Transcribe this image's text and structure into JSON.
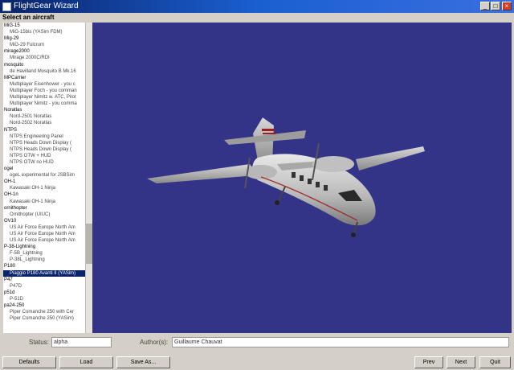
{
  "window": {
    "title": "FlightGear Wizard",
    "minimize": "_",
    "maximize": "□",
    "close": "×"
  },
  "heading": "Select an aircraft",
  "aircraft_list": [
    {
      "label": "MiG-15",
      "kind": "parent"
    },
    {
      "label": "MiG-15bis (YASim FDM)",
      "kind": "child"
    },
    {
      "label": "Mig-29",
      "kind": "parent"
    },
    {
      "label": "MiG-29 Fulcrum",
      "kind": "child"
    },
    {
      "label": "mirage2000",
      "kind": "parent"
    },
    {
      "label": "Mirage 2000C/RDI",
      "kind": "child"
    },
    {
      "label": "mosquito",
      "kind": "parent"
    },
    {
      "label": "de Havilland Mosquito B Mk.16",
      "kind": "child"
    },
    {
      "label": "MPCarrier",
      "kind": "parent"
    },
    {
      "label": "Multiplayer Eisenhower - you c",
      "kind": "child"
    },
    {
      "label": "Multiplayer Foch - you comman",
      "kind": "child"
    },
    {
      "label": "Multiplayer Nimitz w. ATC, Pilot",
      "kind": "child"
    },
    {
      "label": "Multiplayer Nimitz - you comma",
      "kind": "child"
    },
    {
      "label": "Noratlas",
      "kind": "parent"
    },
    {
      "label": "Nord-2501  Noratlas",
      "kind": "child"
    },
    {
      "label": "Nord-2502  Noratlas",
      "kind": "child"
    },
    {
      "label": "NTPS",
      "kind": "parent"
    },
    {
      "label": "NTPS Engineering Panel",
      "kind": "child"
    },
    {
      "label": "NTPS Heads Down Display (",
      "kind": "child"
    },
    {
      "label": "NTPS Heads Down Display (",
      "kind": "child"
    },
    {
      "label": "NTPS OTW + HUD",
      "kind": "child"
    },
    {
      "label": "NTPS OTW no HUD",
      "kind": "child"
    },
    {
      "label": "ogel",
      "kind": "parent"
    },
    {
      "label": "ogeL experimental for JSBSim",
      "kind": "child"
    },
    {
      "label": "OH-1",
      "kind": "parent"
    },
    {
      "label": "Kawasaki OH-1 Ninja",
      "kind": "child"
    },
    {
      "label": "OH-1n",
      "kind": "parent"
    },
    {
      "label": "Kawasaki OH-1 Ninja",
      "kind": "child"
    },
    {
      "label": "ornithopter",
      "kind": "parent"
    },
    {
      "label": "Ornithopter (UIUC)",
      "kind": "child"
    },
    {
      "label": "OV10",
      "kind": "parent"
    },
    {
      "label": "US Air Force Europe North Am",
      "kind": "child"
    },
    {
      "label": "US Air Force Europe North Am",
      "kind": "child"
    },
    {
      "label": "US Air Force Europe North Am",
      "kind": "child"
    },
    {
      "label": "P-38-Lightning",
      "kind": "parent"
    },
    {
      "label": "F-5B_Lightning",
      "kind": "child"
    },
    {
      "label": "P-38L_Lightning",
      "kind": "child"
    },
    {
      "label": "P180",
      "kind": "parent"
    },
    {
      "label": "Piaggio P180 Avanti II (YASim)",
      "kind": "child",
      "selected": true
    },
    {
      "label": "P47",
      "kind": "parent"
    },
    {
      "label": "P47D",
      "kind": "child"
    },
    {
      "label": "p51d",
      "kind": "parent"
    },
    {
      "label": "P-51D",
      "kind": "child"
    },
    {
      "label": "pa24-250",
      "kind": "parent"
    },
    {
      "label": "Piper Comanche 250 with Cer",
      "kind": "child"
    },
    {
      "label": "Piper Comanche 250 (YASim)",
      "kind": "child"
    }
  ],
  "status": {
    "label": "Status:",
    "value": "alpha"
  },
  "author": {
    "label": "Author(s):",
    "value": "Guillaume Chauvat"
  },
  "buttons": {
    "defaults": "Defaults",
    "load": "Load",
    "save_as": "Save As...",
    "prev": "Prev",
    "next": "Next",
    "quit": "Quit"
  },
  "colors": {
    "viewport_bg": "#333388",
    "selection": "#0a246a",
    "title_bar": "#0a246a"
  }
}
